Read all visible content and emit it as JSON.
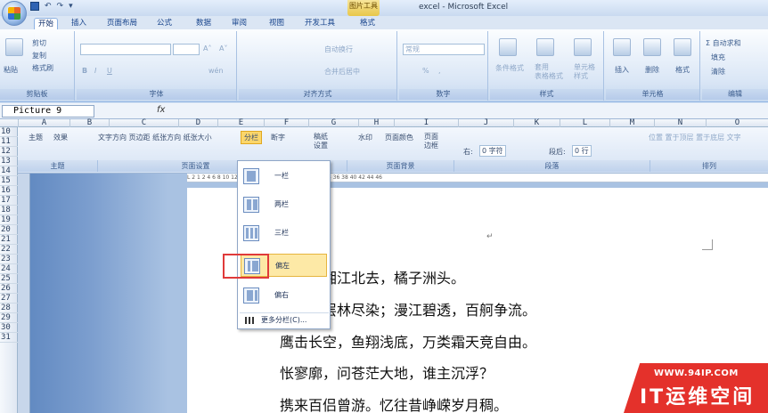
{
  "title_bar": {
    "window_title": "excel - Microsoft Excel",
    "context_tab_title": "图片工具",
    "qat": [
      "↶",
      "↷",
      "▾"
    ]
  },
  "tabs": [
    "开始",
    "插入",
    "页面布局",
    "公式",
    "数据",
    "审阅",
    "视图",
    "开发工具",
    "格式"
  ],
  "ribbon": {
    "clipboard": {
      "paste": "粘贴",
      "cut": "剪切",
      "copy": "复制",
      "format_painter": "格式刷",
      "label": "剪贴板"
    },
    "font": {
      "label": "字体",
      "bold": "B",
      "italic": "I",
      "underline": "U",
      "grow": "A˄",
      "shrink": "A˅",
      "phonetic": "wén"
    },
    "alignment": {
      "wrap": "自动换行",
      "merge": "合并后居中",
      "label": "对齐方式"
    },
    "number": {
      "format": "常规",
      "label": "数字",
      "percent": "%",
      "comma": ","
    },
    "styles": {
      "conditional": "条件格式",
      "table": "套用\n表格格式",
      "cell": "单元格\n样式",
      "label": "样式"
    },
    "cells": {
      "insert": "插入",
      "delete": "删除",
      "format": "格式",
      "label": "单元格"
    },
    "editing": {
      "autosum": "Σ 自动求和",
      "fill": "填充",
      "clear": "清除",
      "label": "编辑"
    }
  },
  "formula_bar": {
    "name_box": "Picture 9",
    "fx": "fx",
    "formula": ""
  },
  "columns": [
    "A",
    "B",
    "C",
    "D",
    "E",
    "F",
    "G",
    "H",
    "I",
    "J",
    "K",
    "L",
    "M",
    "N",
    "O"
  ],
  "rows": [
    "10",
    "11",
    "12",
    "13",
    "14",
    "15",
    "16",
    "17",
    "18",
    "19",
    "20",
    "21",
    "22",
    "23",
    "24",
    "25",
    "26",
    "27",
    "28",
    "29",
    "30",
    "31"
  ],
  "word_ribbon": {
    "theme_label": "主题",
    "theme_btn": "主题",
    "effects_btn": "效果",
    "page_setup_items": "文字方向 页边距 纸张方向 纸张大小",
    "columns_btn": "分栏",
    "breaks_btn": "断字",
    "page_setup_label": "页面设置",
    "draft_paper": "稿纸\n设置",
    "draft_label": "稿纸",
    "watermark": "水印",
    "page_color": "页面颜色",
    "page_border": "页面\n边框",
    "page_bg_label": "页面背景",
    "indent_right_label": "右:",
    "indent_right_value": "0 字符",
    "spacing_after_label": "段后:",
    "spacing_after_value": "0 行",
    "paragraph_label": "段落",
    "arrange_items": "位置 置于顶层 置于底层 文字",
    "arrange_label": "排列",
    "ruler": "L 2 1 2 4 6 8 10 12 14 16 18 20 22 24 26 28 30 32 34 36 38 40 42 44 46"
  },
  "columns_menu": {
    "items": [
      {
        "label": "一栏",
        "bars": 1
      },
      {
        "label": "两栏",
        "bars": 2
      },
      {
        "label": "三栏",
        "bars": 3
      },
      {
        "label": "偏左",
        "bars": 2,
        "highlight": true
      },
      {
        "label": "偏右",
        "bars": 2
      }
    ],
    "more": "更多分栏(C)..."
  },
  "poem": {
    "lines": [
      "春秋，湘江北去，橘子洲头。",
      "红遍，层林尽染；漫江碧透，百舸争流。",
      "鹰击长空，鱼翔浅底，万类霜天竞自由。",
      "怅寥廓，问苍茫大地，谁主沉浮？",
      "携来百侣曾游。忆往昔峥嵘岁月稠。"
    ],
    "para_mark": "↵"
  },
  "watermark": {
    "url": "WWW.94IP.COM",
    "name": "IT运维空间"
  },
  "colors": {
    "selection_border": "#e03a3a",
    "ribbon_text": "#15428b",
    "watermark": "#e4312b"
  }
}
